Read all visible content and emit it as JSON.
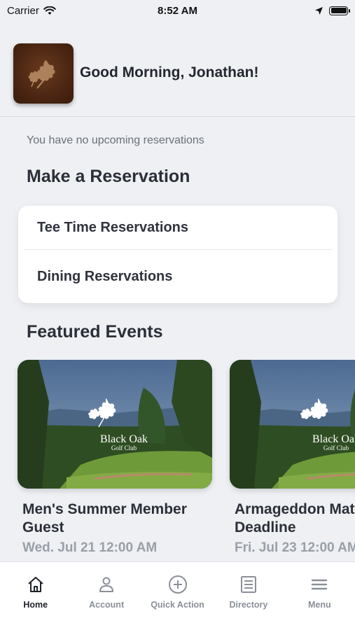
{
  "status_bar": {
    "carrier": "Carrier",
    "time": "8:52 AM"
  },
  "header": {
    "greeting": "Good Morning, Jonathan!"
  },
  "reservations": {
    "empty_message": "You have no upcoming reservations",
    "title": "Make a Reservation",
    "items": [
      {
        "label": "Tee Time Reservations"
      },
      {
        "label": "Dining Reservations"
      }
    ]
  },
  "featured": {
    "title": "Featured Events",
    "logo_name": "Black Oak",
    "logo_sub": "Golf Club",
    "events": [
      {
        "title": "Men's Summer Member Guest",
        "date": "Wed. Jul 21 12:00 AM"
      },
      {
        "title": "Armageddon Match Deadline",
        "date": "Fri. Jul 23 12:00 AM"
      }
    ]
  },
  "tabs": [
    {
      "label": "Home",
      "icon": "home-icon",
      "active": true
    },
    {
      "label": "Account",
      "icon": "account-icon",
      "active": false
    },
    {
      "label": "Quick Action",
      "icon": "plus-circle-icon",
      "active": false
    },
    {
      "label": "Directory",
      "icon": "directory-icon",
      "active": false
    },
    {
      "label": "Menu",
      "icon": "menu-icon",
      "active": false
    }
  ],
  "colors": {
    "background": "#eef0f4",
    "card": "#ffffff",
    "logo_brown": "#4b2612",
    "muted": "#9aa0a8"
  }
}
